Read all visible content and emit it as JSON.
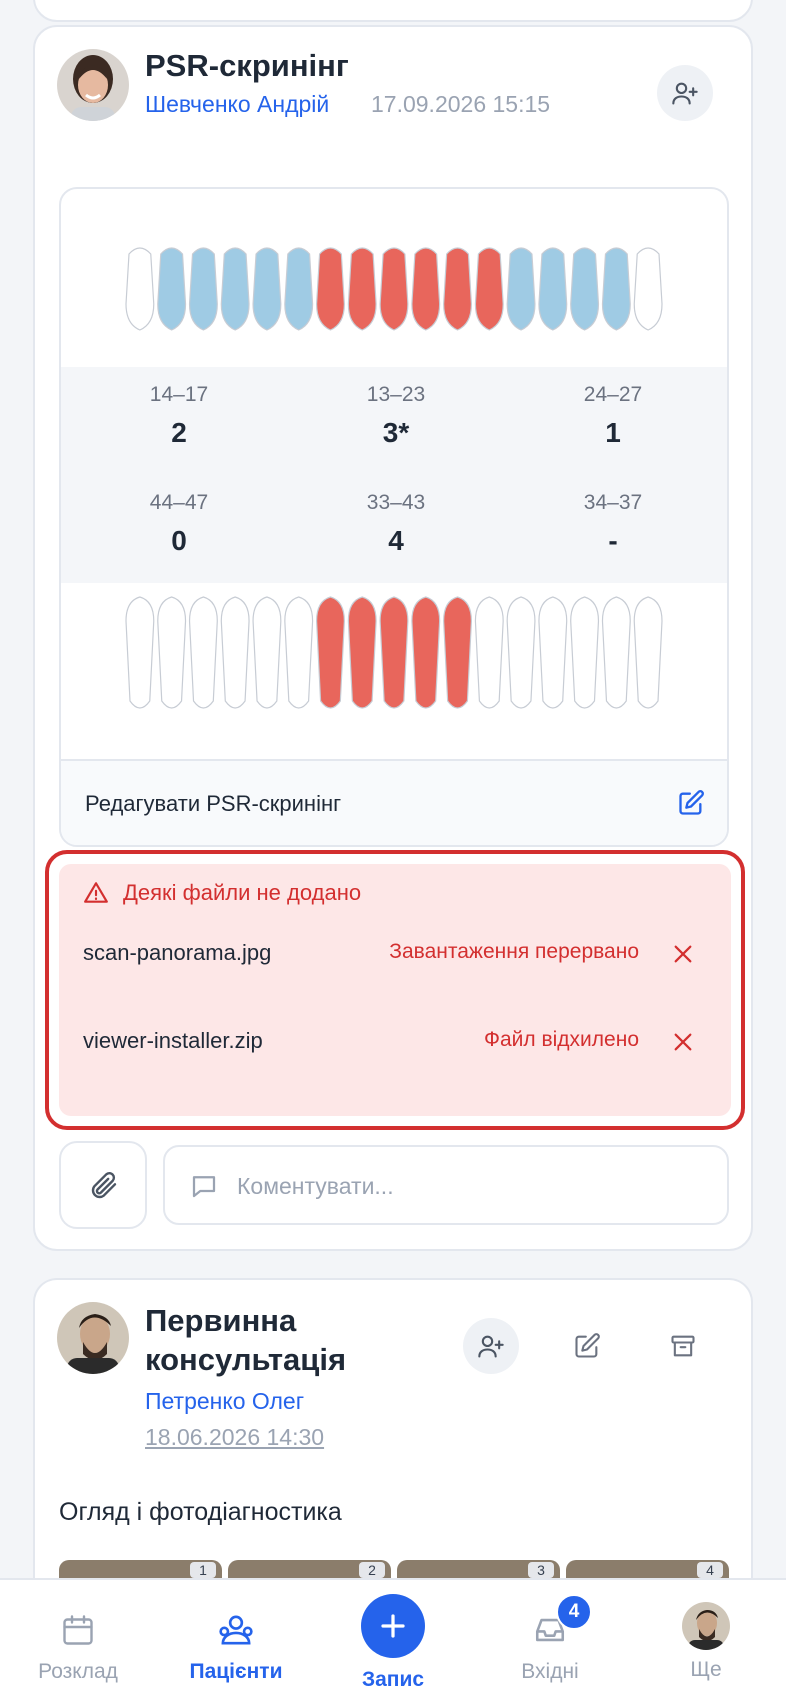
{
  "psr_card": {
    "title": "PSR-скринінг",
    "author": "Шевченко Андрій",
    "date": "17.09.2026 15:15",
    "scores": [
      {
        "range": "14–17",
        "value": "2"
      },
      {
        "range": "13–23",
        "value": "3*"
      },
      {
        "range": "24–27",
        "value": "1"
      },
      {
        "range": "44–47",
        "value": "0"
      },
      {
        "range": "33–43",
        "value": "4"
      },
      {
        "range": "34–37",
        "value": "-"
      }
    ],
    "edit_label": "Редагувати PSR-скринінг",
    "colors": {
      "blue": "#9fcbe4",
      "red": "#e8665c"
    }
  },
  "upload_error": {
    "title": "Деякі файли не додано",
    "files": [
      {
        "name": "scan-panorama.jpg",
        "status": "Завантаження перервано"
      },
      {
        "name": "viewer-installer.zip",
        "status": "Файл відхилено"
      }
    ]
  },
  "comment": {
    "placeholder": "Коментувати..."
  },
  "consult_card": {
    "title_line1": "Первинна",
    "title_line2": "консультація",
    "author": "Петренко Олег",
    "date": "18.06.2026 14:30",
    "description": "Огляд і фотодіагностика",
    "thumb_numbers": [
      "1",
      "2",
      "3",
      "4"
    ]
  },
  "tabbar": {
    "schedule": "Розклад",
    "patients": "Пацієнти",
    "add": "Запис",
    "inbox": "Вхідні",
    "inbox_badge": "4",
    "more": "Ще"
  },
  "accent": "#2563eb",
  "error_color": "#d32f2f"
}
